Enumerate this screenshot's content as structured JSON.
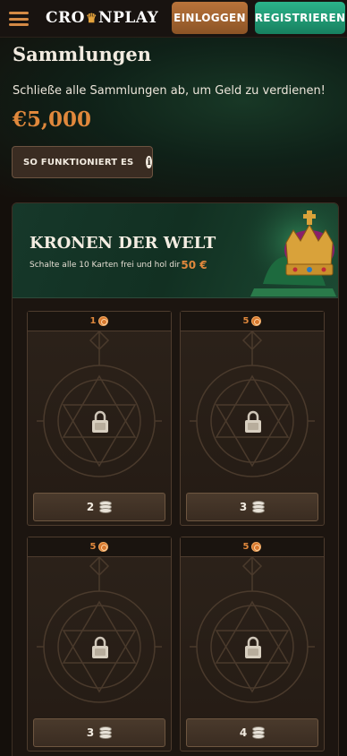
{
  "header": {
    "logo_left": "CRO",
    "logo_right": "NPLAY",
    "login_label": "EINLOGGEN",
    "register_label": "REGISTRIEREN"
  },
  "hero": {
    "title": "Sammlungen",
    "subtitle": "Schließe alle Sammlungen ab, um Geld zu verdienen!",
    "amount": "€5,000",
    "how_label": "SO FUNKTIONIERT ES"
  },
  "collection": {
    "title": "KRONEN DER WELT",
    "subtitle": "Schalte alle 10 Karten frei und hol dir",
    "reward": "50 €"
  },
  "cards": [
    {
      "cost": "1",
      "chips": "2"
    },
    {
      "cost": "5",
      "chips": "3"
    },
    {
      "cost": "5",
      "chips": "3"
    },
    {
      "cost": "5",
      "chips": "4"
    }
  ],
  "colors": {
    "accent": "#e0883c",
    "login_button": "#a8672f",
    "register_button": "#1f9c74",
    "background": "#140f0b"
  },
  "icons": [
    "hamburger-menu-icon",
    "crown-icon",
    "info-icon",
    "coin-icon",
    "lock-icon",
    "chip-stack-icon"
  ]
}
